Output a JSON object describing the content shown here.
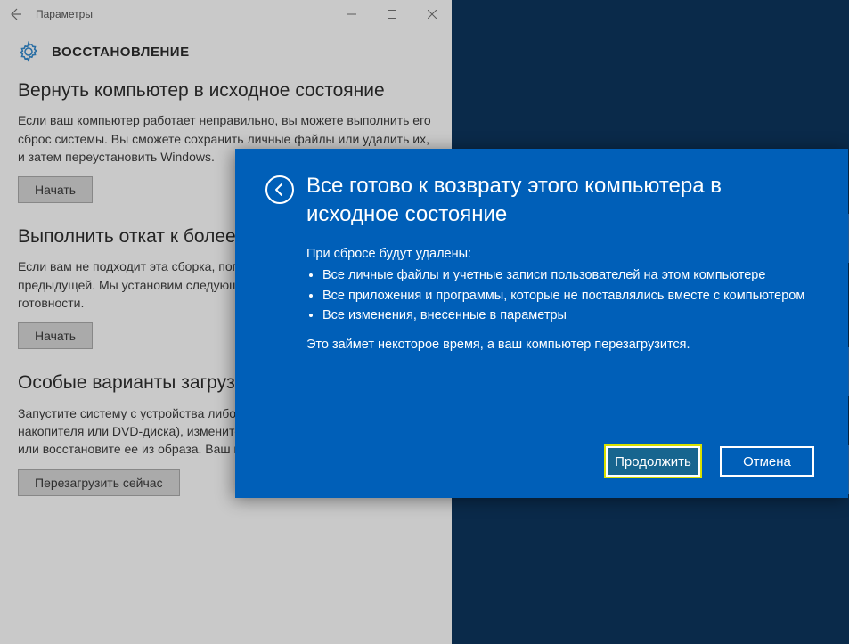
{
  "settings": {
    "window_title": "Параметры",
    "page_title": "ВОССТАНОВЛЕНИЕ",
    "sections": {
      "reset": {
        "heading": "Вернуть компьютер в исходное состояние",
        "body": "Если ваш компьютер работает неправильно, вы можете выполнить его сброс системы. Вы сможете сохранить личные файлы или удалить их, и затем переустановить Windows.",
        "button": "Начать"
      },
      "rollback": {
        "heading": "Выполнить откат к более ранней сборке",
        "body": "Если вам не подходит эта сборка, попробуйте выполнить откат к предыдущей. Мы установим следующую сборку по мере её готовности.",
        "button": "Начать"
      },
      "advanced": {
        "heading": "Особые варианты загрузки",
        "body": "Запустите систему с устройства либо диска (например, USB-накопителя или DVD-диска), измените параметры загрузки Windows или восстановите ее из образа. Ваш компьютер перезагрузится.",
        "button": "Перезагрузить сейчас"
      }
    }
  },
  "modal": {
    "title": "Все готово к возврату этого компьютера в исходное состояние",
    "intro": "При сбросе будут удалены:",
    "bullets": [
      "Все личные файлы и учетные записи пользователей на этом компьютере",
      "Все приложения и программы, которые не поставлялись вместе с компьютером",
      "Все изменения, внесенные в параметры"
    ],
    "note": "Это займет некоторое время, а ваш компьютер перезагрузится.",
    "continue": "Продолжить",
    "cancel": "Отмена"
  }
}
